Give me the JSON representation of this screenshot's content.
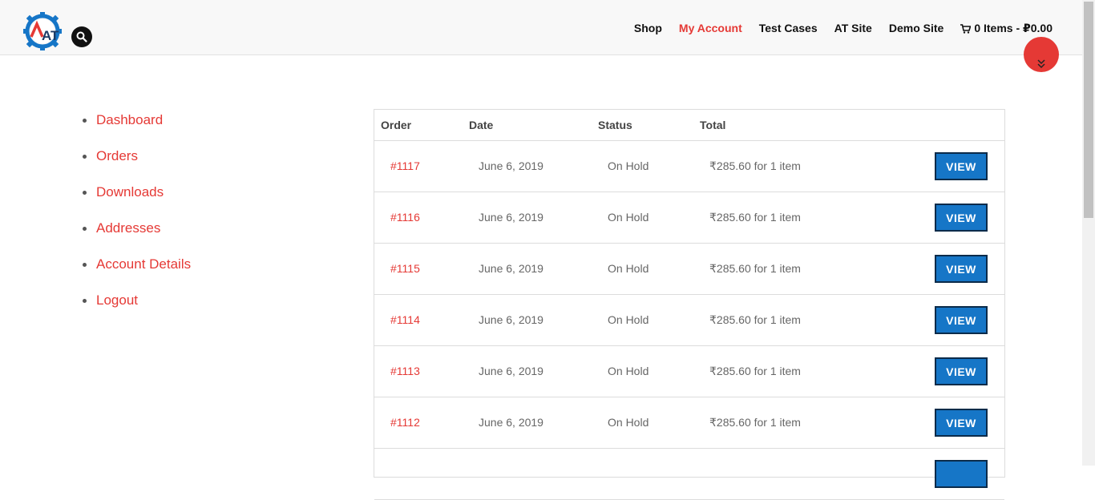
{
  "header": {
    "nav": [
      {
        "label": "Shop",
        "active": false
      },
      {
        "label": "My Account",
        "active": true
      },
      {
        "label": "Test Cases",
        "active": false
      },
      {
        "label": "AT Site",
        "active": false
      },
      {
        "label": "Demo Site",
        "active": false
      }
    ],
    "cart_label": "0 Items - ₽0.00",
    "logo_text": "AT"
  },
  "account_menu": [
    "Dashboard",
    "Orders",
    "Downloads",
    "Addresses",
    "Account Details",
    "Logout"
  ],
  "orders_table": {
    "columns": [
      "Order",
      "Date",
      "Status",
      "Total"
    ],
    "rows": [
      {
        "order": "#1117",
        "date": "June 6, 2019",
        "status": "On Hold",
        "total": "₹285.60 for 1 item",
        "action": "VIEW"
      },
      {
        "order": "#1116",
        "date": "June 6, 2019",
        "status": "On Hold",
        "total": "₹285.60 for 1 item",
        "action": "VIEW"
      },
      {
        "order": "#1115",
        "date": "June 6, 2019",
        "status": "On Hold",
        "total": "₹285.60 for 1 item",
        "action": "VIEW"
      },
      {
        "order": "#1114",
        "date": "June 6, 2019",
        "status": "On Hold",
        "total": "₹285.60 for 1 item",
        "action": "VIEW"
      },
      {
        "order": "#1113",
        "date": "June 6, 2019",
        "status": "On Hold",
        "total": "₹285.60 for 1 item",
        "action": "VIEW"
      },
      {
        "order": "#1112",
        "date": "June 6, 2019",
        "status": "On Hold",
        "total": "₹285.60 for 1 item",
        "action": "VIEW"
      }
    ]
  },
  "colors": {
    "accent": "#e53935",
    "button": "#1676c7"
  },
  "icons": [
    "search-icon",
    "cart-icon",
    "chevron-double-down-icon"
  ]
}
